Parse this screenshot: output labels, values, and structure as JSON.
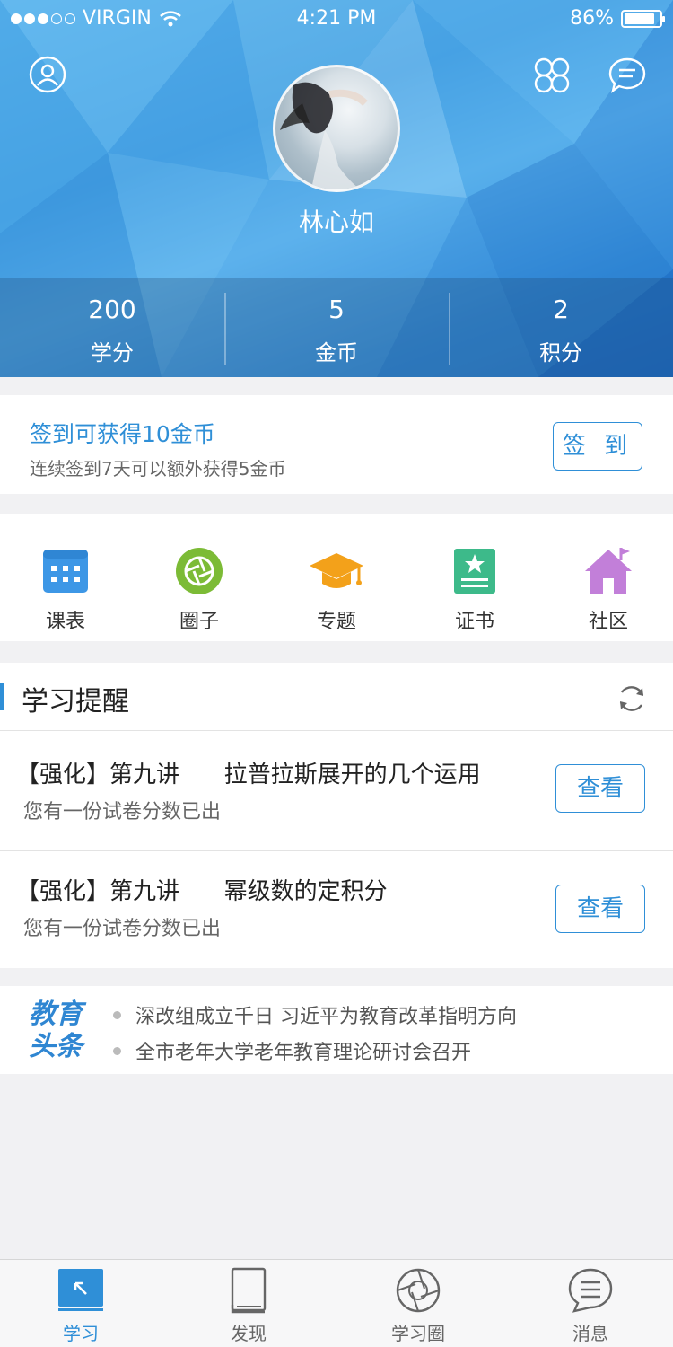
{
  "status_bar": {
    "carrier": "VIRGIN",
    "signal_bars_filled": 3,
    "signal_bars_total": 5,
    "time": "4:21 PM",
    "battery": "86%",
    "battery_level": 0.86
  },
  "profile": {
    "name": "林心如",
    "stats": [
      {
        "value": "200",
        "label": "学分"
      },
      {
        "value": "5",
        "label": "金币"
      },
      {
        "value": "2",
        "label": "积分"
      }
    ]
  },
  "signin": {
    "title": "签到可获得10金币",
    "subtitle": "连续签到7天可以额外获得5金币",
    "button": "签 到"
  },
  "menu": [
    {
      "label": "课表",
      "icon": "calendar-icon",
      "color": "#3d97e6"
    },
    {
      "label": "圈子",
      "icon": "aperture-icon",
      "color": "#7cbb36"
    },
    {
      "label": "专题",
      "icon": "graduation-cap-icon",
      "color": "#f3a11a"
    },
    {
      "label": "证书",
      "icon": "certificate-icon",
      "color": "#3dba8a"
    },
    {
      "label": "社区",
      "icon": "house-icon",
      "color": "#c27fd9"
    }
  ],
  "reminders": {
    "title": "学习提醒",
    "items": [
      {
        "title": "【强化】第九讲      拉普拉斯展开的几个运用",
        "subtitle": "您有一份试卷分数已出",
        "button": "查看"
      },
      {
        "title": "【强化】第九讲      幂级数的定积分",
        "subtitle": "您有一份试卷分数已出",
        "button": "查看"
      }
    ]
  },
  "news": {
    "logo": [
      "教育",
      "头条"
    ],
    "items": [
      "深改组成立千日 习近平为教育改革指明方向",
      "全市老年大学老年教育理论研讨会召开"
    ]
  },
  "tabbar": [
    {
      "label": "学习",
      "icon": "study-icon",
      "active": true
    },
    {
      "label": "发现",
      "icon": "book-icon",
      "active": false
    },
    {
      "label": "学习圈",
      "icon": "aperture-icon",
      "active": false
    },
    {
      "label": "消息",
      "icon": "message-icon",
      "active": false
    }
  ],
  "colors": {
    "accent": "#2f8fd7",
    "header_blue": "#3f9be0"
  }
}
